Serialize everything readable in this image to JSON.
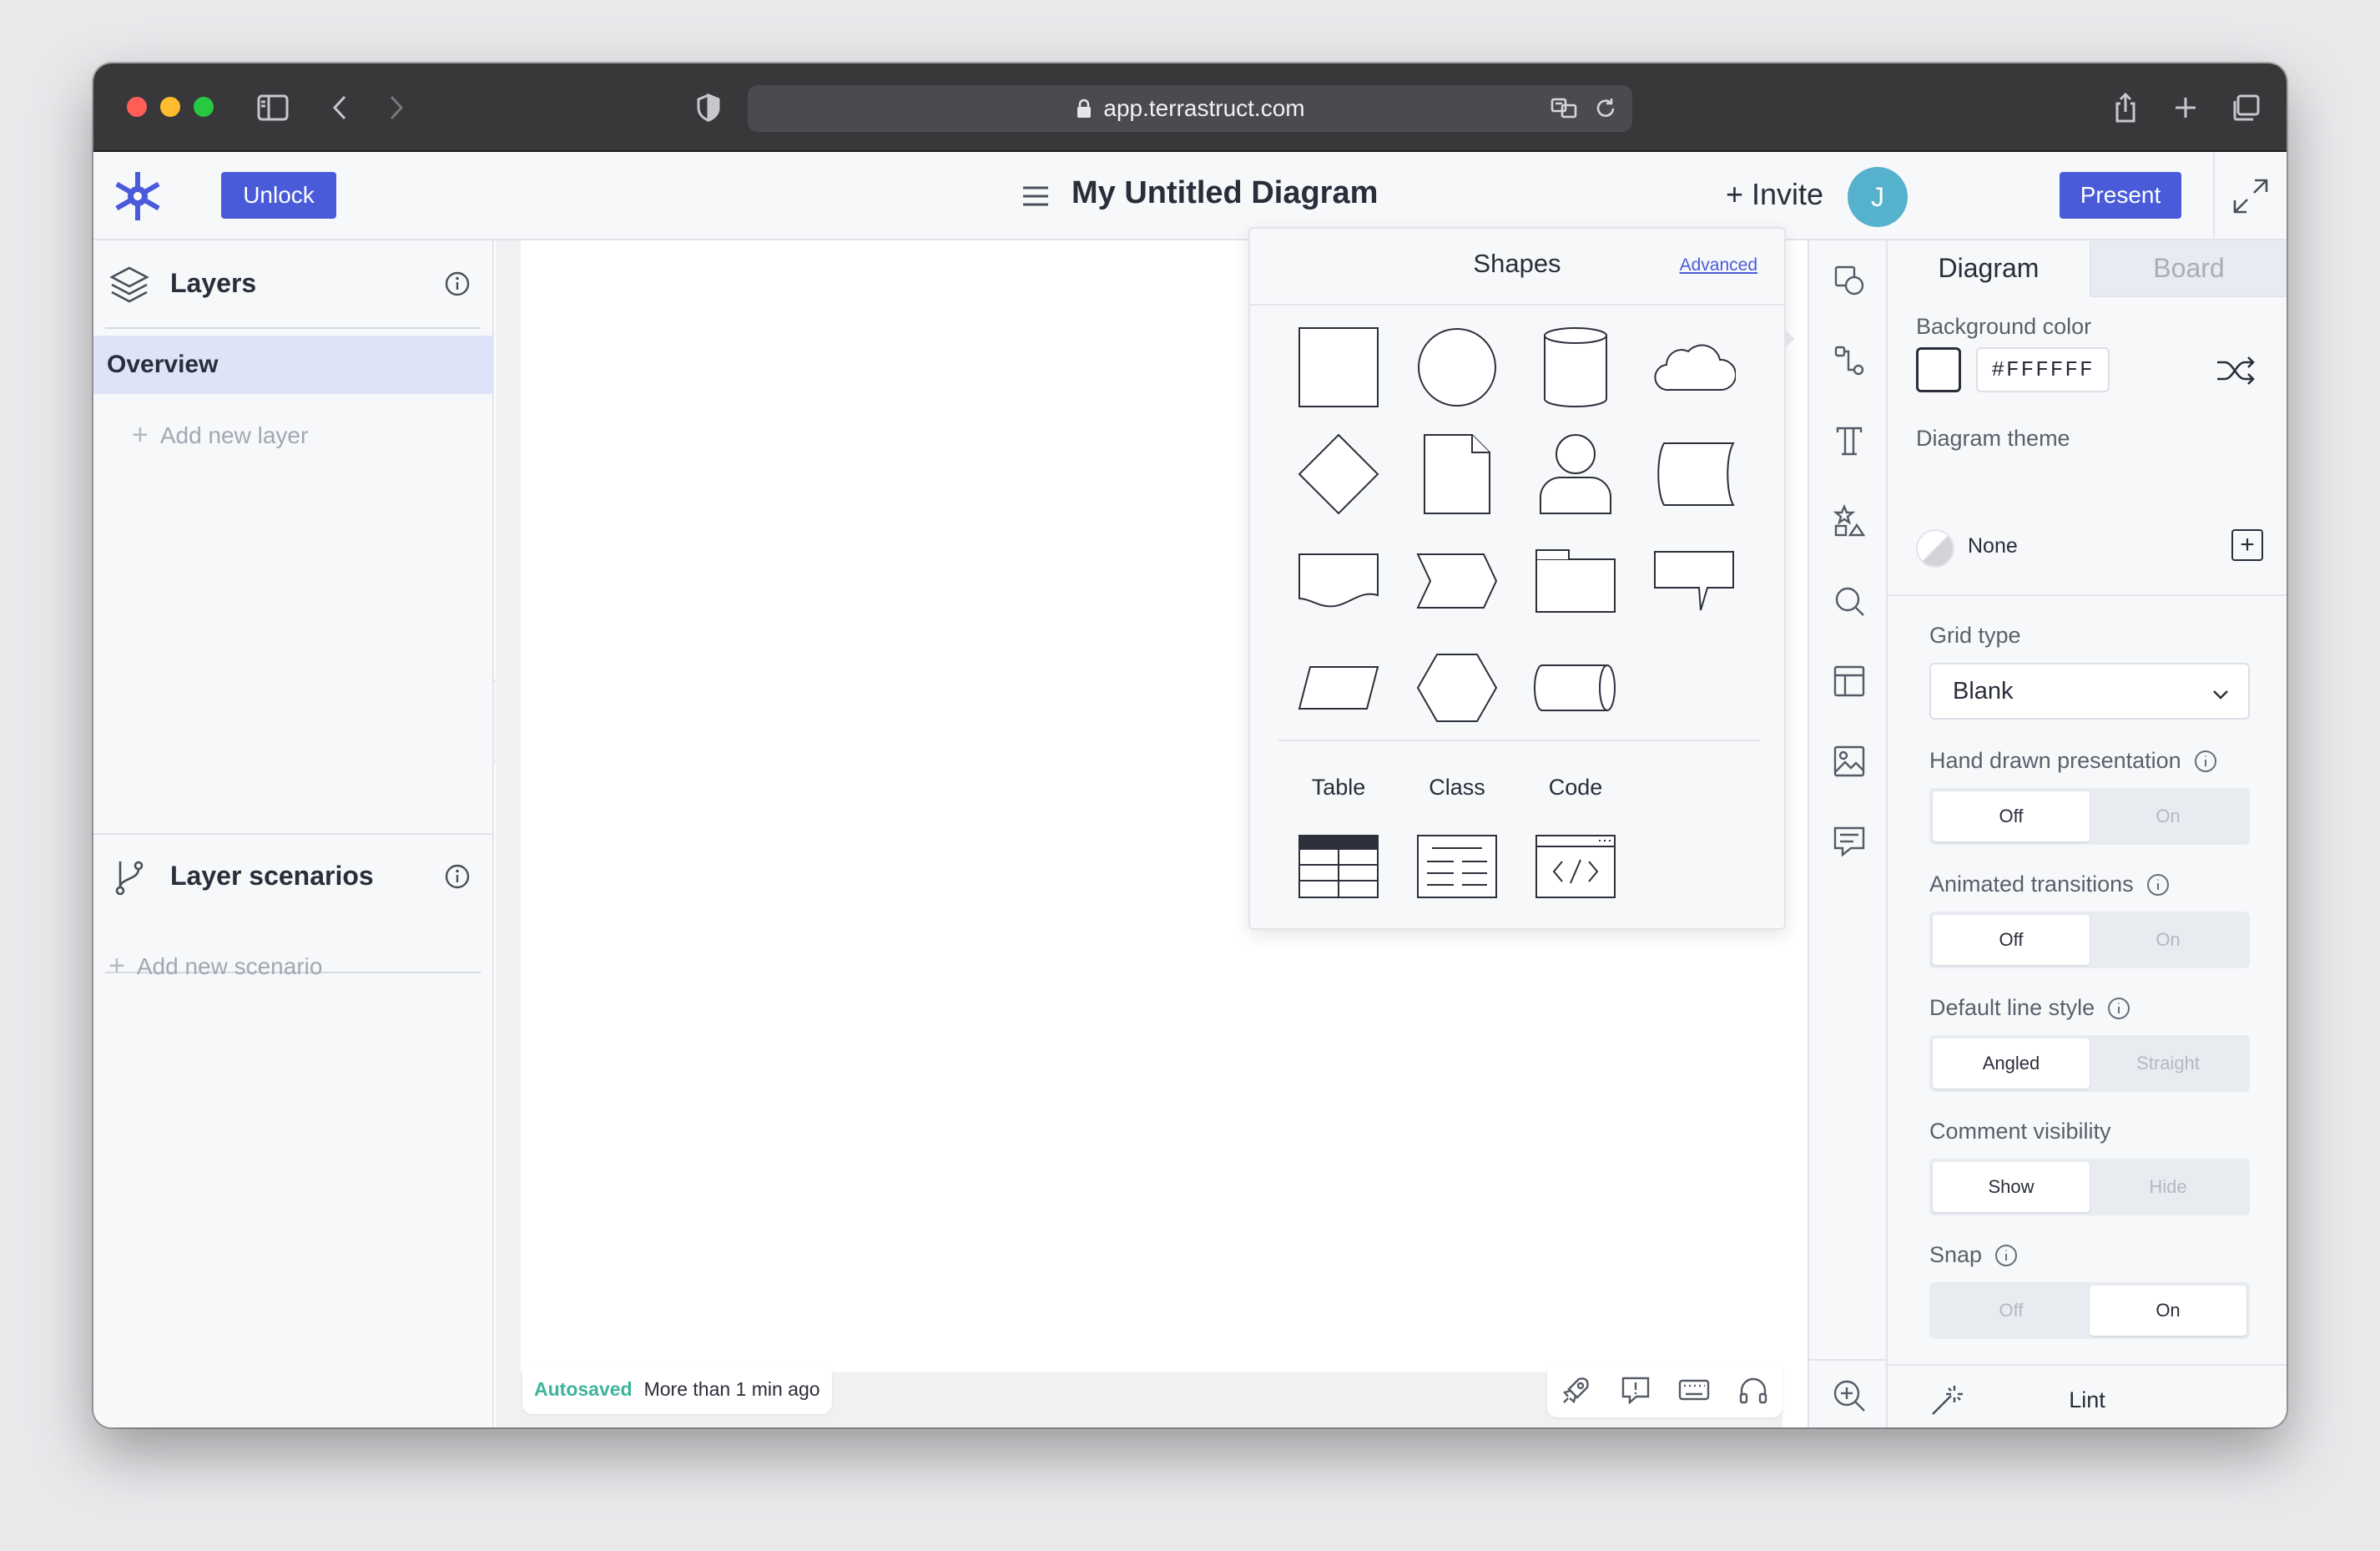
{
  "browser": {
    "url": "app.terrastruct.com"
  },
  "header": {
    "unlock_label": "Unlock",
    "title": "My Untitled Diagram",
    "invite_label": "+ Invite",
    "avatar_initial": "J",
    "present_label": "Present"
  },
  "left_panel": {
    "layers_title": "Layers",
    "overview_label": "Overview",
    "add_layer_label": "Add new layer",
    "scenarios_title": "Layer scenarios",
    "add_scenario_label": "Add new scenario",
    "collapse_glyph": "«"
  },
  "canvas": {
    "autosaved_label": "Autosaved",
    "autosaved_time": "More than 1 min ago"
  },
  "shapes_panel": {
    "title": "Shapes",
    "advanced_link": "Advanced",
    "shapes": [
      "rectangle",
      "circle",
      "cylinder",
      "cloud",
      "diamond",
      "page",
      "person",
      "stored-data",
      "document",
      "step",
      "package",
      "callout",
      "parallelogram",
      "hexagon",
      "queue"
    ],
    "special_labels": [
      "Table",
      "Class",
      "Code"
    ]
  },
  "tool_rail": {
    "icons": [
      "shapes-icon",
      "connection-icon",
      "text-icon",
      "icons-icon",
      "search-icon",
      "layout-icon",
      "image-icon",
      "comment-icon",
      "zoom-in-icon"
    ]
  },
  "right_panel": {
    "tab_diagram": "Diagram",
    "tab_board": "Board",
    "background_color_label": "Background color",
    "background_color_value": "#FFFFFF",
    "diagram_theme_label": "Diagram theme",
    "diagram_theme_value": "None",
    "theme_add_glyph": "+",
    "grid_type_label": "Grid type",
    "grid_type_value": "Blank",
    "hand_drawn_label": "Hand drawn presentation",
    "hand_drawn_off": "Off",
    "hand_drawn_on": "On",
    "animated_label": "Animated transitions",
    "animated_off": "Off",
    "animated_on": "On",
    "line_style_label": "Default line style",
    "line_style_angled": "Angled",
    "line_style_straight": "Straight",
    "comment_visibility_label": "Comment visibility",
    "comment_show": "Show",
    "comment_hide": "Hide",
    "snap_label": "Snap",
    "snap_off": "Off",
    "snap_on": "On",
    "lint_label": "Lint"
  },
  "colors": {
    "accent": "#4a5bd9",
    "avatar": "#55b1cc",
    "autosaved": "#3cb49a",
    "selected_layer": "#dfe3f7"
  }
}
